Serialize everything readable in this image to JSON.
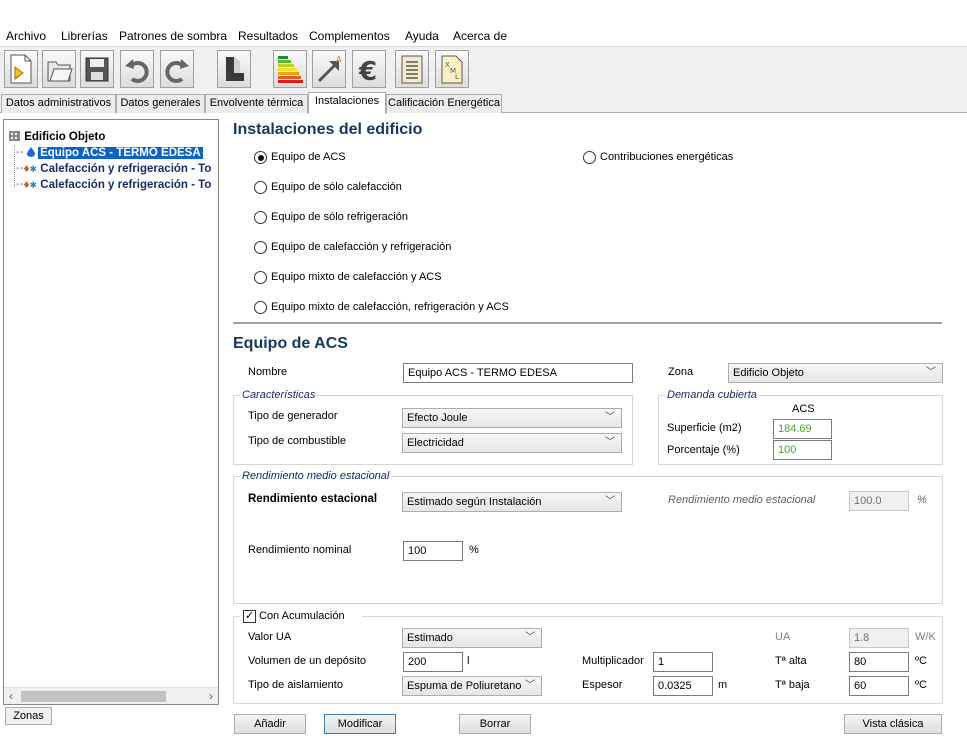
{
  "menu": [
    "Archivo",
    "Librerías",
    "Patrones de sombra",
    "Resultados",
    "Complementos",
    "Ayuda",
    "Acerca de"
  ],
  "toolbar": {
    "icons": [
      "new-file-icon",
      "open-folder-icon",
      "save-icon",
      "undo-icon",
      "redo-icon",
      "building-icon",
      "energy-rating-icon",
      "improvement-arrow-icon",
      "euro-icon",
      "report-icon",
      "xml-file-icon"
    ]
  },
  "tabs": [
    "Datos administrativos",
    "Datos generales",
    "Envolvente térmica",
    "Instalaciones",
    "Calificación Energética"
  ],
  "tree": {
    "root": "Edificio Objeto",
    "items": [
      "Equipo ACS - TERMO EDESA",
      "Calefacción y refrigeración - To",
      "Calefacción y refrigeración - To"
    ]
  },
  "zonas_tab": "Zonas",
  "instalaciones": {
    "title": "Instalaciones del edificio",
    "options": [
      "Equipo de ACS",
      "Equipo de sólo calefacción",
      "Equipo de sólo refrigeración",
      "Equipo de calefacción y refrigeración",
      "Equipo mixto de calefacción y ACS",
      "Equipo mixto de calefacción, refrigeración y ACS"
    ],
    "contribuciones": "Contribuciones energéticas",
    "selected": "Equipo de ACS"
  },
  "equipo": {
    "title": "Equipo de ACS",
    "nombre_label": "Nombre",
    "nombre_value": "Equipo ACS - TERMO EDESA",
    "zona_label": "Zona",
    "zona_value": "Edificio Objeto"
  },
  "caracteristicas": {
    "title": "Características",
    "tipo_generador_label": "Tipo de generador",
    "tipo_generador_value": "Efecto Joule",
    "tipo_combustible_label": "Tipo de combustible",
    "tipo_combustible_value": "Electricidad"
  },
  "demanda": {
    "title": "Demanda cubierta",
    "col": "ACS",
    "superficie_label": "Superficie (m2)",
    "superficie_value": "184.69",
    "porcentaje_label": "Porcentaje (%)",
    "porcentaje_value": "100"
  },
  "rendimiento": {
    "title": "Rendimiento medio estacional",
    "estacional_label": "Rendimiento estacional",
    "estacional_value": "Estimado según Instalación",
    "medio_label": "Rendimiento medio estacional",
    "medio_value": "100.0",
    "medio_unit": "%",
    "nominal_label": "Rendimiento nominal",
    "nominal_value": "100",
    "nominal_unit": "%"
  },
  "acumulacion": {
    "title": "Con Acumulación",
    "checked": "✓",
    "valor_ua_label": "Valor UA",
    "valor_ua_value": "Estimado",
    "volumen_label": "Volumen de un depósito",
    "volumen_value": "200",
    "volumen_unit": "l",
    "aislamiento_label": "Tipo de aislamiento",
    "aislamiento_value": "Espuma de Poliuretano",
    "multiplicador_label": "Multiplicador",
    "multiplicador_value": "1",
    "espesor_label": "Espesor",
    "espesor_value": "0.0325",
    "espesor_unit": "m",
    "ua_label": "UA",
    "ua_value": "1.8",
    "ua_unit": "W/K",
    "t_alta_label": "Tª alta",
    "t_alta_value": "80",
    "t_alta_unit": "ºC",
    "t_baja_label": "Tª baja",
    "t_baja_value": "60",
    "t_baja_unit": "ºC"
  },
  "buttons": {
    "anadir": "Añadir",
    "modificar": "Modificar",
    "borrar": "Borrar",
    "vista_clasica": "Vista clásica"
  }
}
